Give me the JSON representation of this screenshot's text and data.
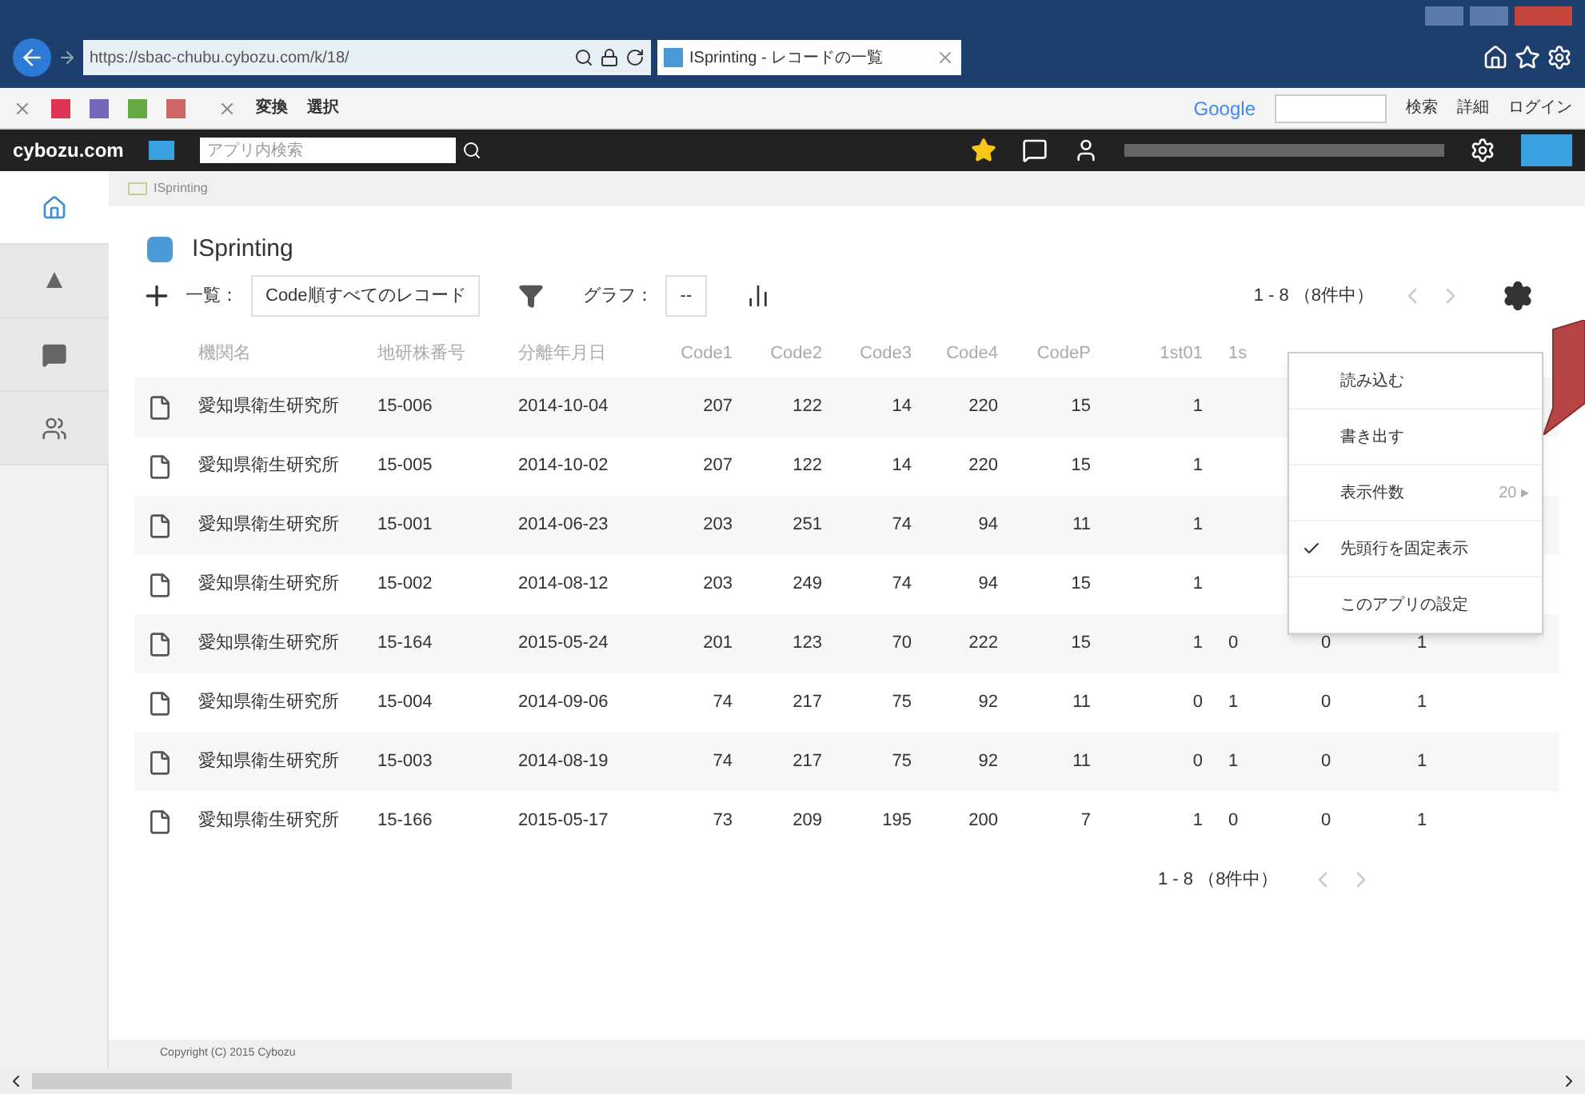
{
  "browser": {
    "url": "https://sbac-chubu.cybozu.com/k/18/",
    "tab_title": "ISprinting - レコードの一覧",
    "favorites_tools": [
      {
        "label": "変換"
      },
      {
        "label": "選択"
      }
    ],
    "search_provider": "Google",
    "search_button": "検索",
    "details": "詳細",
    "login": "ログイン"
  },
  "header": {
    "logo": "cybozu.com",
    "search_placeholder": "アプリ内検索"
  },
  "sidebar": {
    "items": [
      {
        "kind": "home",
        "selected": true
      },
      {
        "kind": "space",
        "selected": false
      },
      {
        "kind": "people",
        "selected": false
      },
      {
        "kind": "user",
        "selected": false
      }
    ]
  },
  "breadcrumb": "ISprinting",
  "app": {
    "title": "ISprinting",
    "view_label": "一覧：",
    "view_value": "Code順すべてのレコード",
    "graph_label": "グラフ：",
    "graph_value": "--",
    "pager": "1 - 8 （8件中）"
  },
  "table": {
    "columns": [
      "機関名",
      "地研株番号",
      "分離年月日",
      "Code1",
      "Code2",
      "Code3",
      "Code4",
      "CodeP",
      "1st01",
      "1s",
      "",
      ""
    ],
    "rows": [
      {
        "cells": [
          "愛知県衛生研究所",
          "15-006",
          "2014-10-04",
          "207",
          "122",
          "14",
          "220",
          "15",
          "1"
        ]
      },
      {
        "cells": [
          "愛知県衛生研究所",
          "15-005",
          "2014-10-02",
          "207",
          "122",
          "14",
          "220",
          "15",
          "1"
        ]
      },
      {
        "cells": [
          "愛知県衛生研究所",
          "15-001",
          "2014-06-23",
          "203",
          "251",
          "74",
          "94",
          "11",
          "1"
        ]
      },
      {
        "cells": [
          "愛知県衛生研究所",
          "15-002",
          "2014-08-12",
          "203",
          "249",
          "74",
          "94",
          "15",
          "1"
        ]
      },
      {
        "cells": [
          "愛知県衛生研究所",
          "15-164",
          "2015-05-24",
          "201",
          "123",
          "70",
          "222",
          "15",
          "1",
          "0",
          "0",
          "1"
        ]
      },
      {
        "cells": [
          "愛知県衛生研究所",
          "15-004",
          "2014-09-06",
          "74",
          "217",
          "75",
          "92",
          "11",
          "0",
          "1",
          "0",
          "1"
        ]
      },
      {
        "cells": [
          "愛知県衛生研究所",
          "15-003",
          "2014-08-19",
          "74",
          "217",
          "75",
          "92",
          "11",
          "0",
          "1",
          "0",
          "1"
        ]
      },
      {
        "cells": [
          "愛知県衛生研究所",
          "15-166",
          "2015-05-17",
          "73",
          "209",
          "195",
          "200",
          "7",
          "1",
          "0",
          "0",
          "1"
        ]
      }
    ]
  },
  "pager_bottom": "1 - 8 （8件中）",
  "menu": {
    "items": [
      {
        "kind": "plain",
        "label": "読み込む"
      },
      {
        "kind": "plain",
        "label": "書き出す"
      },
      {
        "kind": "submenu",
        "label": "表示件数",
        "value": "20 ▸"
      },
      {
        "kind": "check",
        "label": "先頭行を固定表示",
        "checked": true
      },
      {
        "kind": "plain",
        "label": "このアプリの設定"
      }
    ]
  },
  "footer": "Copyright (C) 2015 Cybozu"
}
